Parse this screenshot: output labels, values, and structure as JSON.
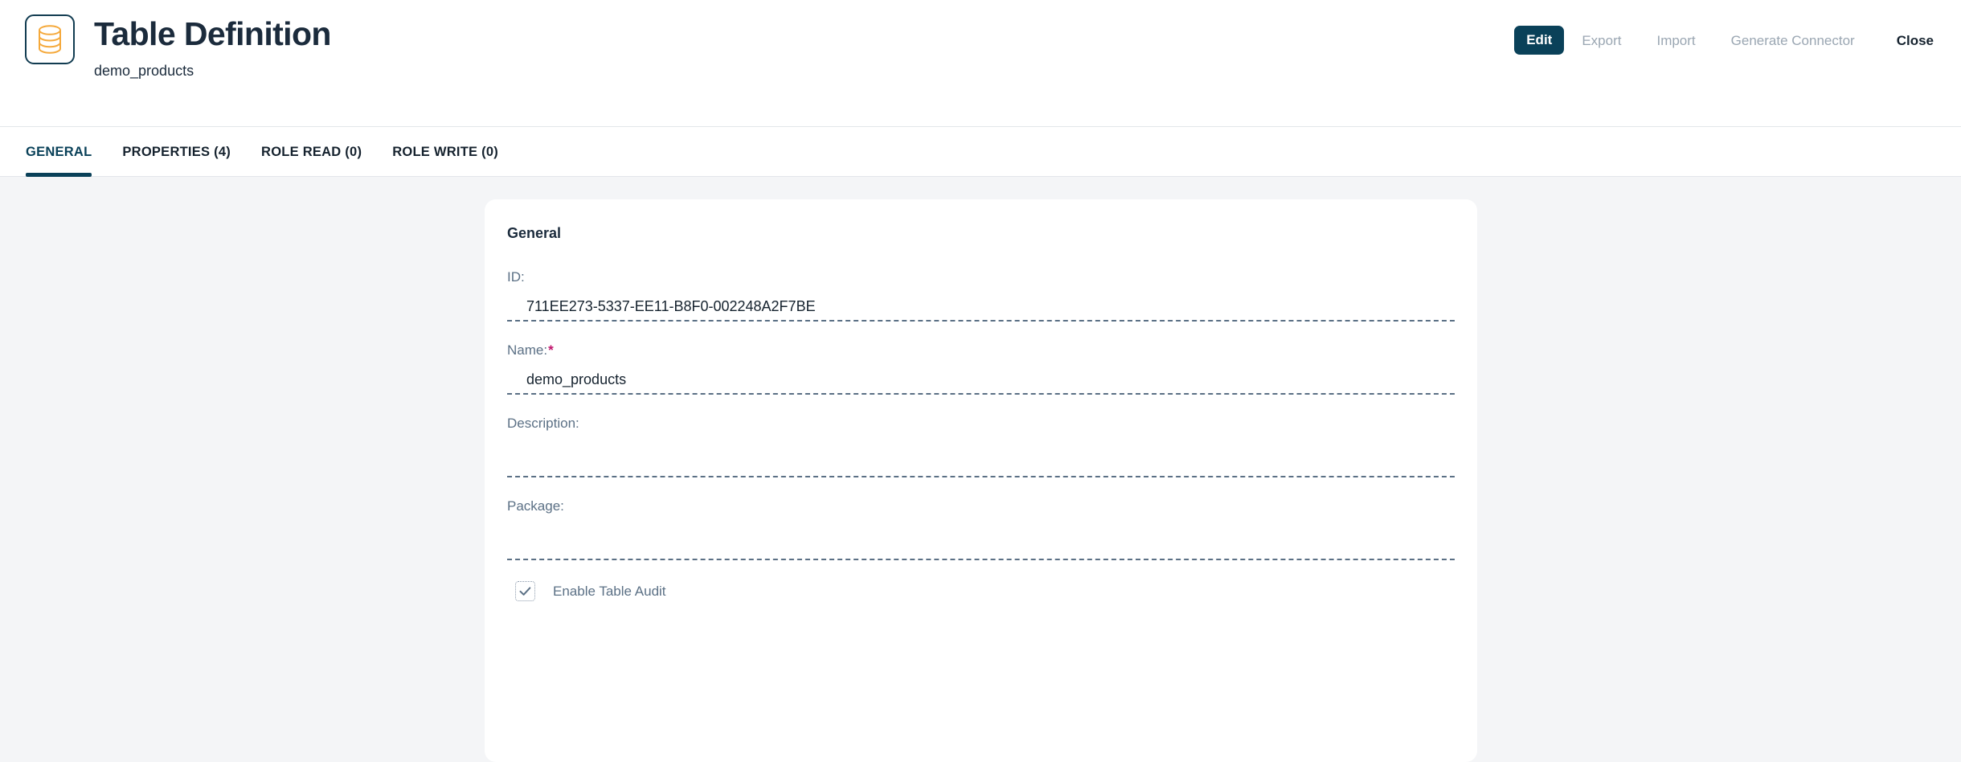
{
  "header": {
    "icon": "database-icon",
    "title": "Table Definition",
    "subtitle": "demo_products",
    "actions": {
      "edit": "Edit",
      "export": "Export",
      "import": "Import",
      "generate_connector": "Generate Connector",
      "close": "Close"
    },
    "accent_color": "#0a4159",
    "icon_color": "#f5a93b"
  },
  "tabs": [
    {
      "label": "GENERAL",
      "active": true
    },
    {
      "label": "PROPERTIES (4)",
      "active": false
    },
    {
      "label": "ROLE READ (0)",
      "active": false
    },
    {
      "label": "ROLE WRITE (0)",
      "active": false
    }
  ],
  "card": {
    "section_title": "General",
    "fields": {
      "id": {
        "label": "ID:",
        "value": "711EE273-5337-EE11-B8F0-002248A2F7BE"
      },
      "name": {
        "label": "Name:",
        "required_marker": "*",
        "value": "demo_products"
      },
      "description": {
        "label": "Description:",
        "value": ""
      },
      "package": {
        "label": "Package:",
        "value": ""
      }
    },
    "checkbox": {
      "label": "Enable Table Audit",
      "checked": true,
      "check_glyph": "check-icon"
    }
  }
}
